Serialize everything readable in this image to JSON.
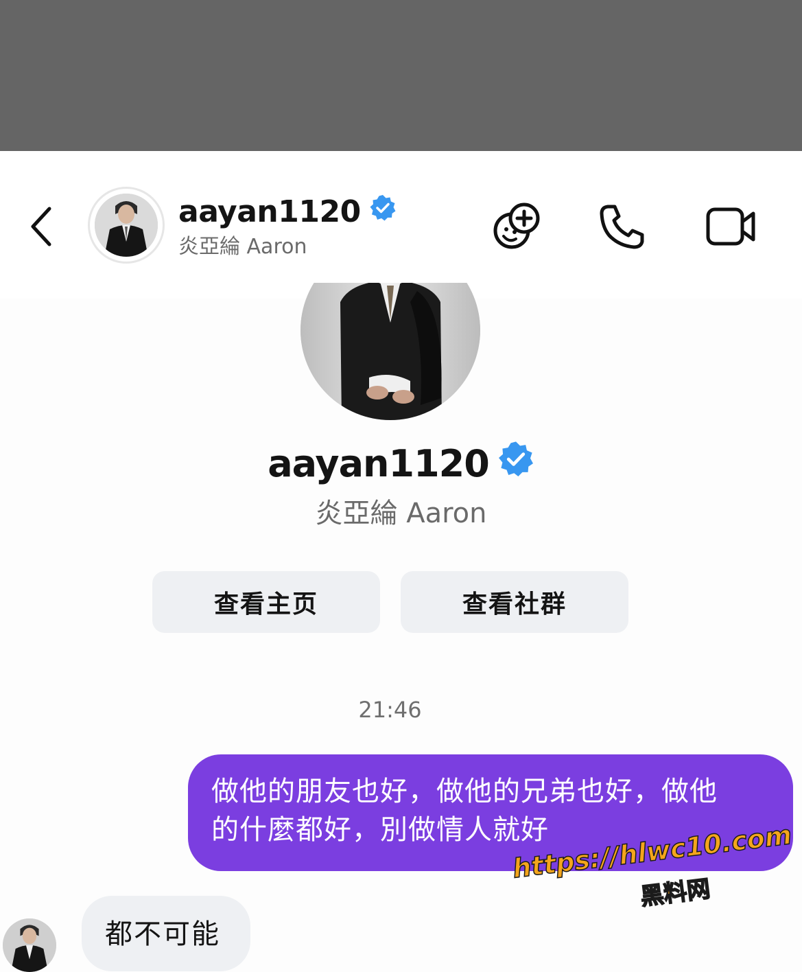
{
  "header": {
    "username": "aayan1120",
    "full_name": "炎亞綸 Aaron",
    "icons": {
      "back": "chevron-left-icon",
      "verified": "verified-badge-icon",
      "effects": "sticker-effects-icon",
      "call": "phone-icon",
      "video": "video-camera-icon"
    }
  },
  "profile": {
    "username": "aayan1120",
    "full_name": "炎亞綸 Aaron",
    "view_profile_label": "查看主页",
    "view_community_label": "查看社群"
  },
  "chat": {
    "timestamp": "21:46",
    "messages": [
      {
        "direction": "sent",
        "lines": [
          "做他的朋友也好，做他的兄弟也好，做他",
          "的什麼都好，別做情人就好"
        ]
      },
      {
        "direction": "received",
        "text": "都不可能"
      }
    ]
  },
  "watermark": {
    "url": "https://hlwc10.com",
    "brand": "黑料网"
  },
  "colors": {
    "top_band": "#656565",
    "sent_bubble": "#7b3ee0",
    "received_bubble": "#eef0f3",
    "verified_blue": "#3897f0",
    "watermark_orange": "#f4a51c"
  }
}
